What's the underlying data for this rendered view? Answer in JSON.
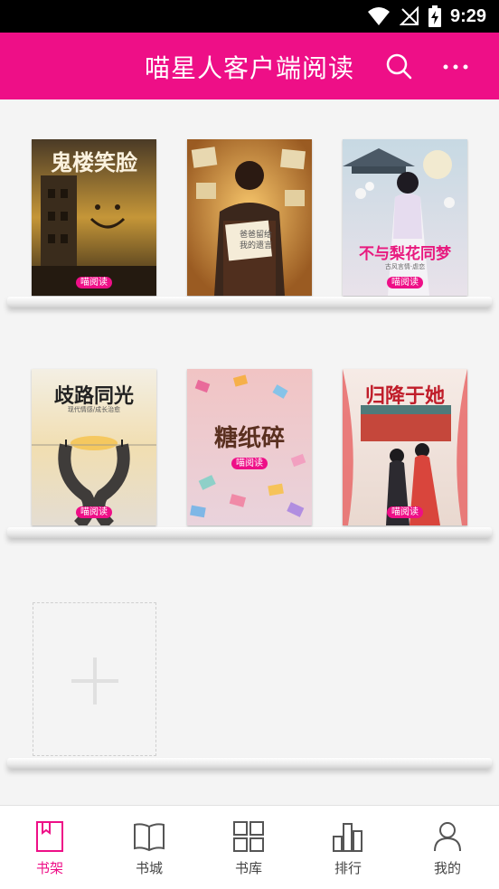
{
  "status_bar": {
    "time": "9:29"
  },
  "app_bar": {
    "title": "喵星人客户端阅读"
  },
  "brand_badge": "喵阅读",
  "books": [
    {
      "title": "鬼楼笑脸"
    },
    {
      "title": "爸爸留给我的遗言",
      "note_line1": "爸爸留给",
      "note_line2": "我的遗言"
    },
    {
      "title": "不与梨花同梦",
      "subtitle": "古风言情·虐恋"
    },
    {
      "title": "歧路同光",
      "subtitle": "现代情感/成长治愈"
    },
    {
      "title": "糖纸碎"
    },
    {
      "title": "归降于她"
    }
  ],
  "add_book": {
    "icon": "plus-icon"
  },
  "bottom_nav": [
    {
      "label": "书架",
      "icon": "bookshelf-icon",
      "active": true
    },
    {
      "label": "书城",
      "icon": "open-book-icon",
      "active": false
    },
    {
      "label": "书库",
      "icon": "grid-icon",
      "active": false
    },
    {
      "label": "排行",
      "icon": "bar-chart-icon",
      "active": false
    },
    {
      "label": "我的",
      "icon": "person-icon",
      "active": false
    }
  ],
  "colors": {
    "accent": "#ee0f87",
    "status_bar": "#000000",
    "background": "#f4f4f4"
  }
}
